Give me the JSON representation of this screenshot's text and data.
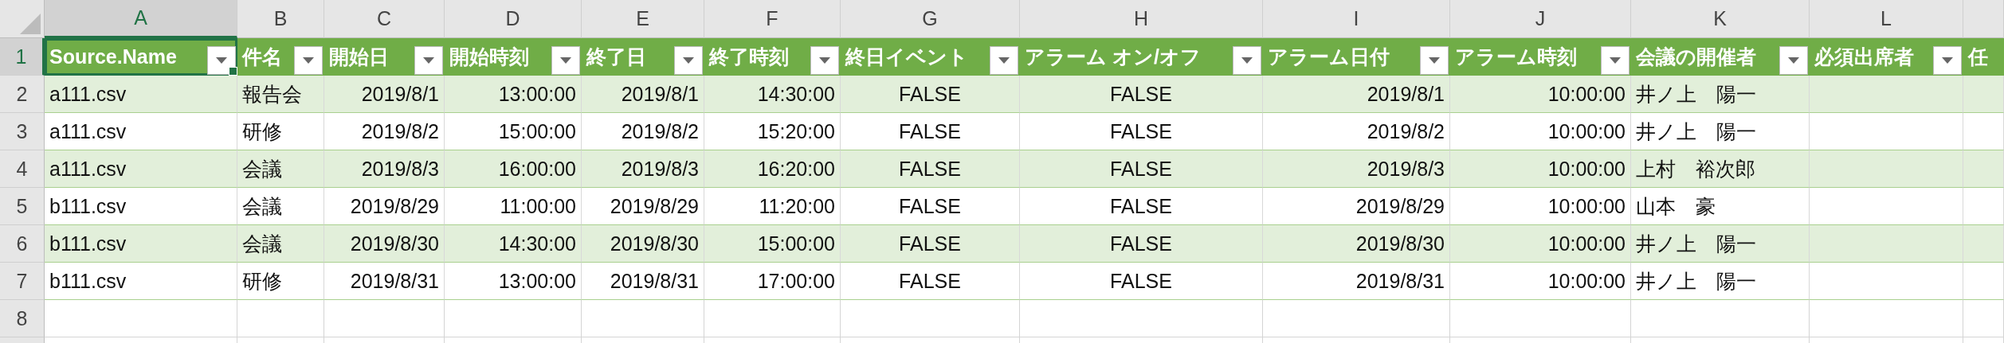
{
  "column_letters": [
    {
      "label": "A",
      "selected": true
    },
    {
      "label": "B",
      "selected": false
    },
    {
      "label": "C",
      "selected": false
    },
    {
      "label": "D",
      "selected": false
    },
    {
      "label": "E",
      "selected": false
    },
    {
      "label": "F",
      "selected": false
    },
    {
      "label": "G",
      "selected": false
    },
    {
      "label": "H",
      "selected": false
    },
    {
      "label": "I",
      "selected": false
    },
    {
      "label": "J",
      "selected": false
    },
    {
      "label": "K",
      "selected": false
    },
    {
      "label": "L",
      "selected": false
    }
  ],
  "row_numbers": [
    {
      "label": "1",
      "selected": true
    },
    {
      "label": "2",
      "selected": false
    },
    {
      "label": "3",
      "selected": false
    },
    {
      "label": "4",
      "selected": false
    },
    {
      "label": "5",
      "selected": false
    },
    {
      "label": "6",
      "selected": false
    },
    {
      "label": "7",
      "selected": false
    },
    {
      "label": "8",
      "selected": false
    }
  ],
  "table": {
    "columns": [
      {
        "label": "Source.Name",
        "kind": "text",
        "filter": true,
        "selected": true
      },
      {
        "label": "件名",
        "kind": "text",
        "filter": true,
        "selected": false
      },
      {
        "label": "開始日",
        "kind": "number",
        "filter": true,
        "selected": false
      },
      {
        "label": "開始時刻",
        "kind": "number",
        "filter": true,
        "selected": false
      },
      {
        "label": "終了日",
        "kind": "number",
        "filter": true,
        "selected": false
      },
      {
        "label": "終了時刻",
        "kind": "number",
        "filter": true,
        "selected": false
      },
      {
        "label": "終日イベント",
        "kind": "boolean",
        "filter": true,
        "selected": false
      },
      {
        "label": "アラーム オン/オフ",
        "kind": "boolean",
        "filter": true,
        "selected": false
      },
      {
        "label": "アラーム日付",
        "kind": "number",
        "filter": true,
        "selected": false
      },
      {
        "label": "アラーム時刻",
        "kind": "number",
        "filter": true,
        "selected": false
      },
      {
        "label": "会議の開催者",
        "kind": "text",
        "filter": true,
        "selected": false
      },
      {
        "label": "必須出席者",
        "kind": "text",
        "filter": true,
        "selected": false
      },
      {
        "label": "任",
        "kind": "text",
        "filter": false,
        "selected": false
      }
    ],
    "rows": [
      {
        "cells": [
          "a111.csv",
          "報告会",
          "2019/8/1",
          "13:00:00",
          "2019/8/1",
          "14:30:00",
          "FALSE",
          "FALSE",
          "2019/8/1",
          "10:00:00",
          "井ノ上　陽一"
        ]
      },
      {
        "cells": [
          "a111.csv",
          "研修",
          "2019/8/2",
          "15:00:00",
          "2019/8/2",
          "15:20:00",
          "FALSE",
          "FALSE",
          "2019/8/2",
          "10:00:00",
          "井ノ上　陽一"
        ]
      },
      {
        "cells": [
          "a111.csv",
          "会議",
          "2019/8/3",
          "16:00:00",
          "2019/8/3",
          "16:20:00",
          "FALSE",
          "FALSE",
          "2019/8/3",
          "10:00:00",
          "上村　裕次郎"
        ]
      },
      {
        "cells": [
          "b111.csv",
          "会議",
          "2019/8/29",
          "11:00:00",
          "2019/8/29",
          "11:20:00",
          "FALSE",
          "FALSE",
          "2019/8/29",
          "10:00:00",
          "山本　豪"
        ]
      },
      {
        "cells": [
          "b111.csv",
          "会議",
          "2019/8/30",
          "14:30:00",
          "2019/8/30",
          "15:00:00",
          "FALSE",
          "FALSE",
          "2019/8/30",
          "10:00:00",
          "井ノ上　陽一"
        ]
      },
      {
        "cells": [
          "b111.csv",
          "研修",
          "2019/8/31",
          "13:00:00",
          "2019/8/31",
          "17:00:00",
          "FALSE",
          "FALSE",
          "2019/8/31",
          "10:00:00",
          "井ノ上　陽一"
        ]
      }
    ]
  }
}
